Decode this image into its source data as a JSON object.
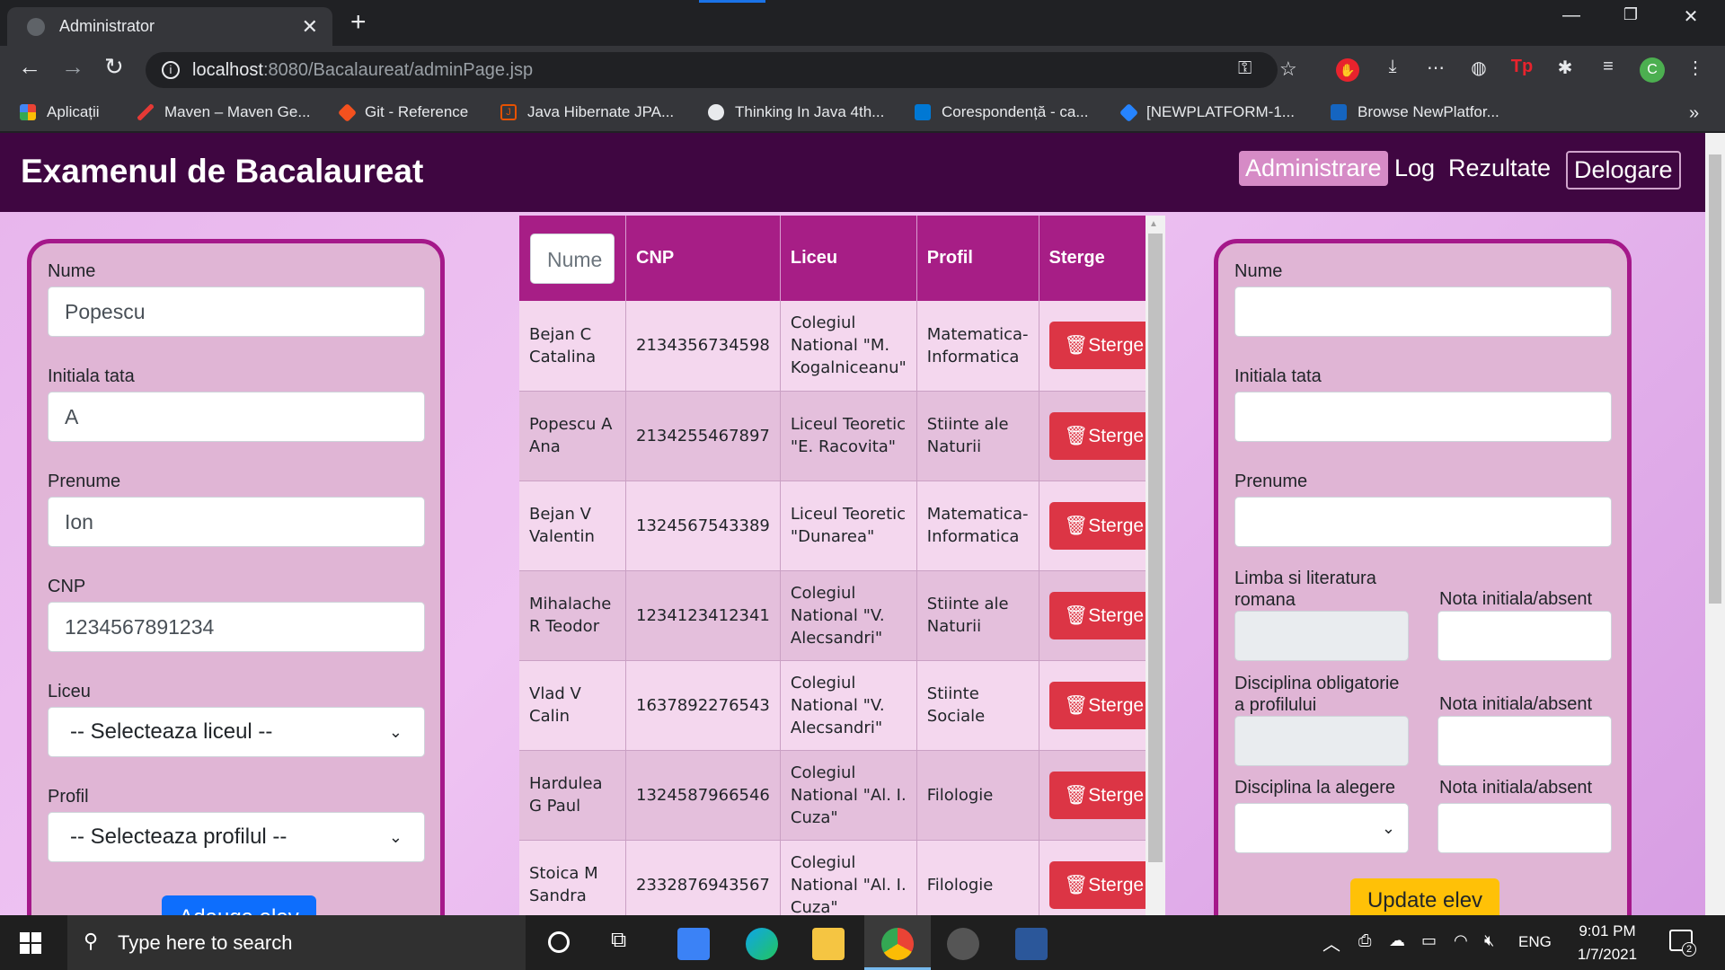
{
  "browser": {
    "tab_title": "Administrator",
    "new_tab_symbol": "+",
    "url_host": "localhost",
    "url_path": ":8080/Bacalaureat/adminPage.jsp",
    "profile_initial": "C",
    "bookmarks": [
      "Aplicații",
      "Maven – Maven Ge...",
      "Git - Reference",
      "Java Hibernate JPA...",
      "Thinking In Java 4th...",
      "Corespondență - ca...",
      "[NEWPLATFORM-1...",
      "Browse NewPlatfor..."
    ],
    "more_bookmarks": "»"
  },
  "navbar": {
    "brand": "Examenul de Bacalaureat",
    "links": [
      "Administrare",
      "Log",
      "Rezultate",
      "Delogare"
    ]
  },
  "add_form": {
    "nume_label": "Nume",
    "nume_value": "Popescu",
    "initiala_label": "Initiala tata",
    "initiala_value": "A",
    "prenume_label": "Prenume",
    "prenume_value": "Ion",
    "cnp_label": "CNP",
    "cnp_value": "1234567891234",
    "liceu_label": "Liceu",
    "liceu_value": "-- Selecteaza liceul --",
    "profil_label": "Profil",
    "profil_value": "-- Selecteaza profilul --",
    "submit": "Adauga elev"
  },
  "table": {
    "filter_placeholder": "Nume",
    "headers": [
      "CNP",
      "Liceu",
      "Profil",
      "Sterge"
    ],
    "delete_label": "Sterge",
    "rows": [
      {
        "nume": "Bejan C Catalina",
        "cnp": "2134356734598",
        "liceu": "Colegiul National \"M. Kogalniceanu\"",
        "profil": "Matematica-Informatica"
      },
      {
        "nume": "Popescu A Ana",
        "cnp": "2134255467897",
        "liceu": "Liceul Teoretic \"E. Racovita\"",
        "profil": "Stiinte ale Naturii"
      },
      {
        "nume": "Bejan V Valentin",
        "cnp": "1324567543389",
        "liceu": "Liceul Teoretic \"Dunarea\"",
        "profil": "Matematica-Informatica"
      },
      {
        "nume": "Mihalache R Teodor",
        "cnp": "1234123412341",
        "liceu": "Colegiul National \"V. Alecsandri\"",
        "profil": "Stiinte ale Naturii"
      },
      {
        "nume": "Vlad V Calin",
        "cnp": "1637892276543",
        "liceu": "Colegiul National \"V. Alecsandri\"",
        "profil": "Stiinte Sociale"
      },
      {
        "nume": "Hardulea G Paul",
        "cnp": "1324587966546",
        "liceu": "Colegiul National \"Al. I. Cuza\"",
        "profil": "Filologie"
      },
      {
        "nume": "Stoica M Sandra",
        "cnp": "2332876943567",
        "liceu": "Colegiul National \"Al. I. Cuza\"",
        "profil": "Filologie"
      }
    ]
  },
  "update_form": {
    "nume_label": "Nume",
    "initiala_label": "Initiala tata",
    "prenume_label": "Prenume",
    "limba_label": "Limba si literatura romana",
    "nota_label": "Nota initiala/absent",
    "disciplina_obl_label": "Disciplina obligatorie a profilului",
    "disciplina_alegere_label": "Disciplina la alegere",
    "submit": "Update elev"
  },
  "taskbar": {
    "search_placeholder": "Type here to search",
    "lang": "ENG",
    "time": "9:01 PM",
    "date": "1/7/2021",
    "notif_count": "2"
  }
}
